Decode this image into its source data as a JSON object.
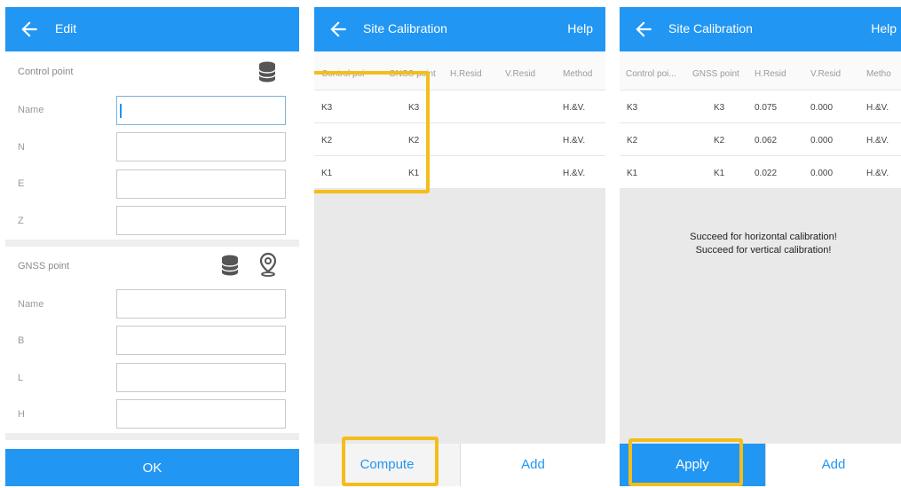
{
  "panel1": {
    "title": "Edit",
    "control_section": "Control point",
    "control_fields": [
      "Name",
      "N",
      "E",
      "Z"
    ],
    "gnss_section": "GNSS point",
    "gnss_fields": [
      "Name",
      "B",
      "L",
      "H"
    ],
    "ok_label": "OK"
  },
  "panel2": {
    "title": "Site Calibration",
    "help": "Help",
    "headers": [
      "Control poi",
      "GNSS point",
      "H.Resid",
      "V.Resid",
      "Method"
    ],
    "rows": [
      {
        "control": "K3",
        "gnss": "K3",
        "hres": "",
        "vres": "",
        "method": "H.&V."
      },
      {
        "control": "K2",
        "gnss": "K2",
        "hres": "",
        "vres": "",
        "method": "H.&V."
      },
      {
        "control": "K1",
        "gnss": "K1",
        "hres": "",
        "vres": "",
        "method": "H.&V."
      }
    ],
    "left_button": "Compute",
    "right_button": "Add"
  },
  "panel3": {
    "title": "Site Calibration",
    "help": "Help",
    "headers": [
      "Control poi...",
      "GNSS point",
      "H.Resid",
      "V.Resid",
      "Metho"
    ],
    "rows": [
      {
        "control": "K3",
        "gnss": "K3",
        "hres": "0.075",
        "vres": "0.000",
        "method": "H.&V."
      },
      {
        "control": "K2",
        "gnss": "K2",
        "hres": "0.062",
        "vres": "0.000",
        "method": "H.&V."
      },
      {
        "control": "K1",
        "gnss": "K1",
        "hres": "0.022",
        "vres": "0.000",
        "method": "H.&V."
      }
    ],
    "message_line1": "Succeed for horizontal calibration!",
    "message_line2": "Succeed for vertical calibration!",
    "left_button": "Apply",
    "right_button": "Add"
  },
  "colors": {
    "primary": "#2196f3",
    "highlight": "#f4bd1c",
    "background_gray": "#e9e9e9"
  },
  "icons": [
    "back-arrow-icon",
    "database-icon",
    "location-pin-icon"
  ]
}
